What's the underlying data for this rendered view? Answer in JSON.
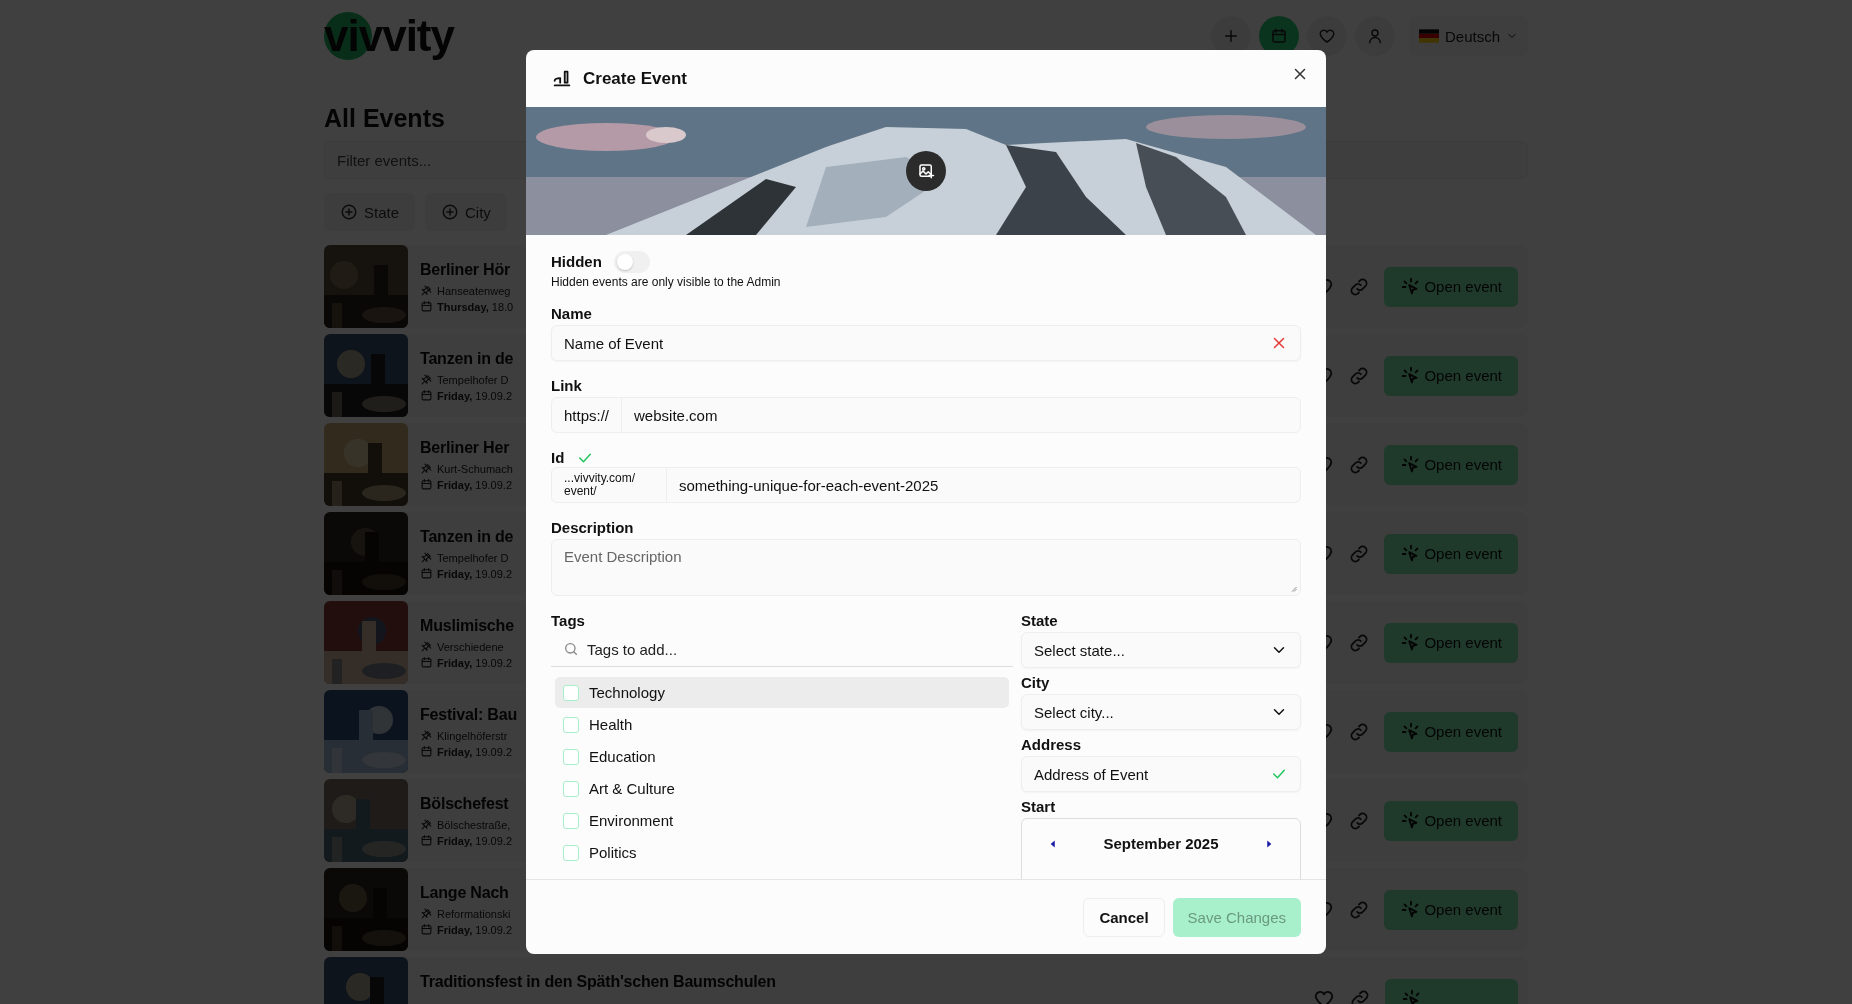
{
  "header": {
    "logo": "vivvity",
    "actions": [
      {
        "kind": "plus",
        "selected": false
      },
      {
        "kind": "calendar",
        "selected": true
      },
      {
        "kind": "heart",
        "selected": false
      },
      {
        "kind": "user",
        "selected": false
      }
    ],
    "language": "Deutsch"
  },
  "page": {
    "title": "All Events",
    "filter": {
      "placeholder": "Filter events..."
    },
    "facets": [
      "State",
      "City"
    ]
  },
  "events": [
    {
      "title": "Berliner Hör",
      "address": "Hanseatenweg",
      "date": "**Thursday,** 18.0",
      "action": "Open event"
    },
    {
      "title": "Tanzen in de",
      "address": "Tempelhofer D",
      "date": "**Friday,** 19.09.2",
      "action": "Open event"
    },
    {
      "title": "Berliner Her",
      "address": "Kurt-Schumach",
      "date": "**Friday,** 19.09.2",
      "action": "Open event"
    },
    {
      "title": "Tanzen in de",
      "address": "Tempelhofer D",
      "date": "**Friday,** 19.09.2",
      "action": "Open event"
    },
    {
      "title": "Muslimische",
      "address": "Verschiedene",
      "date": "**Friday,** 19.09.2",
      "action": "Open event"
    },
    {
      "title": "Festival: Bau",
      "address": "Klingelhöferstr",
      "date": "**Friday,** 19.09.2",
      "action": "Open event"
    },
    {
      "title": "Bölschefest",
      "address": "Bölschestraße,",
      "date": "**Friday,** 19.09.2",
      "action": "Open event"
    },
    {
      "title": "Lange Nach",
      "address": "Reformationski",
      "date": "**Friday,** 19.09.2",
      "action": "Open event"
    },
    {
      "title": "Traditionsfest in den Späth'schen Baumschulen"
    }
  ],
  "dialog": {
    "title": "Create Event",
    "hidden": {
      "label": "Hidden",
      "on": false,
      "hint": "Hidden events are only visible to the Admin"
    },
    "name": {
      "label": "Name",
      "value": "Name of Event",
      "valid": false
    },
    "link": {
      "label": "Link",
      "prefix": "https://",
      "value": "website.com"
    },
    "id": {
      "label": "Id",
      "valid": true,
      "prefix": "...vivvity.com/ event/",
      "value": "something-unique-for-each-event-2025"
    },
    "description": {
      "label": "Description",
      "placeholder": "Event Description"
    },
    "tags": {
      "label": "Tags",
      "placeholder": "Tags to add...",
      "items": [
        {
          "label": "Technology",
          "checked": false,
          "highlighted": true
        },
        {
          "label": "Health",
          "checked": false,
          "highlighted": false
        },
        {
          "label": "Education",
          "checked": false,
          "highlighted": false
        },
        {
          "label": "Art & Culture",
          "checked": false,
          "highlighted": false
        },
        {
          "label": "Environment",
          "checked": false,
          "highlighted": false
        },
        {
          "label": "Politics",
          "checked": false,
          "highlighted": false
        }
      ]
    },
    "state": {
      "label": "State",
      "placeholder": "Select state..."
    },
    "city": {
      "label": "City",
      "placeholder": "Select city..."
    },
    "address": {
      "label": "Address",
      "value": "Address of Event",
      "valid": true
    },
    "start": {
      "label": "Start",
      "month": "September 2025"
    },
    "buttons": [
      {
        "label": "Cancel",
        "kind": "secondary",
        "disabled": false
      },
      {
        "label": "Save Changes",
        "kind": "primary",
        "disabled": true
      }
    ]
  }
}
